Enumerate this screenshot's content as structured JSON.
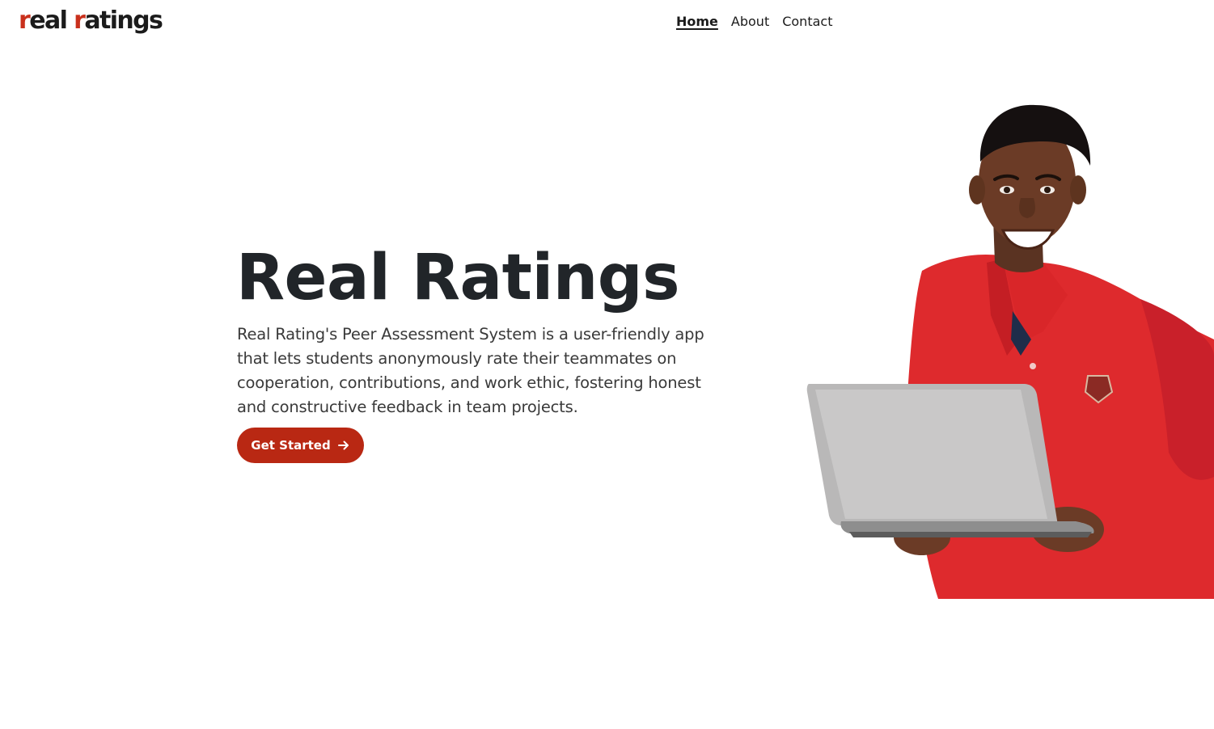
{
  "brand": {
    "part1": "real",
    "part2": "r",
    "part3": "atings",
    "accent_color": "#c9301c"
  },
  "nav": {
    "items": [
      {
        "label": "Home",
        "active": true
      },
      {
        "label": "About",
        "active": false
      },
      {
        "label": "Contact",
        "active": false
      }
    ]
  },
  "hero": {
    "title": "Real Ratings",
    "description": "Real Rating's Peer Assessment System is a user-friendly app that lets students anonymously rate their teammates on cooperation, contributions, and work ethic, fostering honest and constructive feedback in team projects.",
    "cta_label": "Get Started",
    "cta_icon": "arrow-right-icon",
    "cta_color": "#b92813",
    "image_subject": "student-with-laptop-illustration"
  }
}
